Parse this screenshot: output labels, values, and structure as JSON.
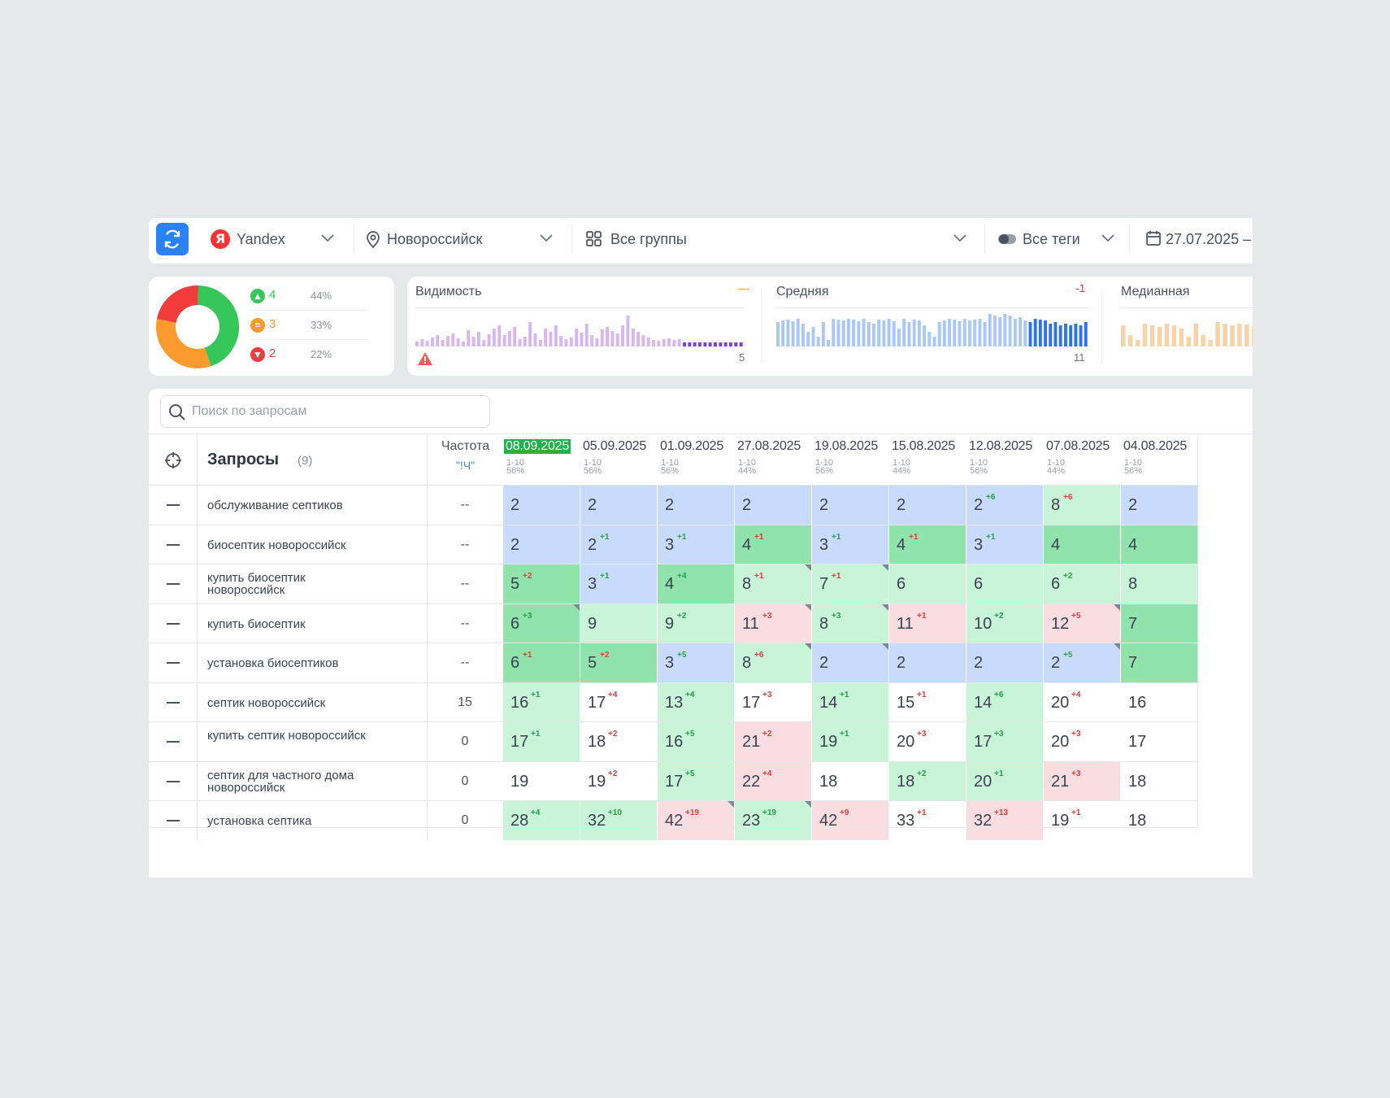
{
  "toolbar": {
    "engine": "Yandex",
    "engine_logo": "Я",
    "region": "Новороссийск",
    "groups": "Все группы",
    "tags": "Все теги",
    "date_range": "27.07.2025 –"
  },
  "summary": {
    "donut": {
      "segments": [
        {
          "name": "up",
          "count": "4",
          "pct": "44%",
          "color": "#35c759"
        },
        {
          "name": "same",
          "count": "3",
          "pct": "33%",
          "color": "#fb9a2d"
        },
        {
          "name": "down",
          "count": "2",
          "pct": "22%",
          "color": "#f23b3b"
        }
      ]
    },
    "sparks": [
      {
        "title": "Видимость",
        "delta": "—",
        "delta_color": "#fb9a2d",
        "value": "5",
        "color": "#d8b6f0",
        "highlight": "#7b3fe0",
        "warning": true
      },
      {
        "title": "Средняя",
        "delta": "-1",
        "delta_color": "#f23b3b",
        "value": "11",
        "color": "#a9c8f7",
        "highlight": "#2d74e6",
        "warning": false
      },
      {
        "title": "Медианная",
        "delta": "",
        "delta_color": "#f23b3b",
        "value": "",
        "color": "#f7d3aa",
        "highlight": "#f7d3aa",
        "warning": false
      }
    ]
  },
  "search": {
    "placeholder": "Поиск по запросам"
  },
  "table": {
    "title": "Запросы",
    "count": "(9)",
    "freq_title": "Частота",
    "freq_sub": "\"!Ч\"",
    "dates": [
      {
        "date": "08.09.2025",
        "range": "1-10",
        "pct": "56%",
        "active": true
      },
      {
        "date": "05.09.2025",
        "range": "1-10",
        "pct": "56%"
      },
      {
        "date": "01.09.2025",
        "range": "1-10",
        "pct": "56%"
      },
      {
        "date": "27.08.2025",
        "range": "1-10",
        "pct": "44%"
      },
      {
        "date": "19.08.2025",
        "range": "1-10",
        "pct": "56%"
      },
      {
        "date": "15.08.2025",
        "range": "1-10",
        "pct": "44%"
      },
      {
        "date": "12.08.2025",
        "range": "1-10",
        "pct": "56%"
      },
      {
        "date": "07.08.2025",
        "range": "1-10",
        "pct": "44%"
      },
      {
        "date": "04.08.2025",
        "range": "1-10",
        "pct": "56%"
      }
    ],
    "rows": [
      {
        "query": "обслуживание септиков",
        "freq": "--",
        "cells": [
          {
            "v": "2",
            "c": "blue"
          },
          {
            "v": "2",
            "c": "blue"
          },
          {
            "v": "2",
            "c": "blue"
          },
          {
            "v": "2",
            "c": "blue"
          },
          {
            "v": "2",
            "c": "blue"
          },
          {
            "v": "2",
            "c": "blue"
          },
          {
            "v": "2",
            "c": "blue",
            "d": "+6",
            "t": "up"
          },
          {
            "v": "8",
            "c": "lgreen",
            "d": "+6",
            "t": "down"
          },
          {
            "v": "2",
            "c": "blue"
          }
        ]
      },
      {
        "query": "биосептик новороссийск",
        "freq": "--",
        "cells": [
          {
            "v": "2",
            "c": "blue"
          },
          {
            "v": "2",
            "c": "blue",
            "d": "+1",
            "t": "up"
          },
          {
            "v": "3",
            "c": "blue",
            "d": "+1",
            "t": "up"
          },
          {
            "v": "4",
            "c": "dgreen",
            "d": "+1",
            "t": "down"
          },
          {
            "v": "3",
            "c": "blue",
            "d": "+1",
            "t": "up"
          },
          {
            "v": "4",
            "c": "dgreen",
            "d": "+1",
            "t": "down"
          },
          {
            "v": "3",
            "c": "blue",
            "d": "+1",
            "t": "up"
          },
          {
            "v": "4",
            "c": "dgreen"
          },
          {
            "v": "4",
            "c": "dgreen"
          }
        ]
      },
      {
        "query": "купить биосептик новороссийск",
        "freq": "--",
        "cells": [
          {
            "v": "5",
            "c": "dgreen",
            "d": "+2",
            "t": "down"
          },
          {
            "v": "3",
            "c": "blue",
            "d": "+1",
            "t": "up"
          },
          {
            "v": "4",
            "c": "dgreen",
            "d": "+4",
            "t": "up"
          },
          {
            "v": "8",
            "c": "lgreen",
            "d": "+1",
            "t": "down",
            "m": true
          },
          {
            "v": "7",
            "c": "lgreen",
            "d": "+1",
            "t": "down",
            "m": true
          },
          {
            "v": "6",
            "c": "lgreen"
          },
          {
            "v": "6",
            "c": "lgreen"
          },
          {
            "v": "6",
            "c": "lgreen",
            "d": "+2",
            "t": "up"
          },
          {
            "v": "8",
            "c": "lgreen"
          }
        ]
      },
      {
        "query": "купить биосептик",
        "freq": "--",
        "cells": [
          {
            "v": "6",
            "c": "dgreen",
            "d": "+3",
            "t": "up",
            "m": true
          },
          {
            "v": "9",
            "c": "lgreen"
          },
          {
            "v": "9",
            "c": "lgreen",
            "d": "+2",
            "t": "up"
          },
          {
            "v": "11",
            "c": "pink",
            "d": "+3",
            "t": "down",
            "m": true
          },
          {
            "v": "8",
            "c": "lgreen",
            "d": "+3",
            "t": "up",
            "m": true
          },
          {
            "v": "11",
            "c": "pink",
            "d": "+1",
            "t": "down"
          },
          {
            "v": "10",
            "c": "lgreen",
            "d": "+2",
            "t": "up"
          },
          {
            "v": "12",
            "c": "pink",
            "d": "+5",
            "t": "down",
            "m": true
          },
          {
            "v": "7",
            "c": "dgreen"
          }
        ]
      },
      {
        "query": "установка биосептиков",
        "freq": "--",
        "cells": [
          {
            "v": "6",
            "c": "dgreen",
            "d": "+1",
            "t": "down"
          },
          {
            "v": "5",
            "c": "dgreen",
            "d": "+2",
            "t": "down"
          },
          {
            "v": "3",
            "c": "blue",
            "d": "+5",
            "t": "up"
          },
          {
            "v": "8",
            "c": "lgreen",
            "d": "+6",
            "t": "down",
            "m": true
          },
          {
            "v": "2",
            "c": "blue",
            "m": true
          },
          {
            "v": "2",
            "c": "blue"
          },
          {
            "v": "2",
            "c": "blue"
          },
          {
            "v": "2",
            "c": "blue",
            "d": "+5",
            "t": "up",
            "m": true
          },
          {
            "v": "7",
            "c": "dgreen"
          }
        ]
      },
      {
        "query": "септик новороссийск",
        "freq": "15",
        "cells": [
          {
            "v": "16",
            "c": "lgreen",
            "d": "+1",
            "t": "up"
          },
          {
            "v": "17",
            "c": "white",
            "d": "+4",
            "t": "down"
          },
          {
            "v": "13",
            "c": "lgreen",
            "d": "+4",
            "t": "up"
          },
          {
            "v": "17",
            "c": "white",
            "d": "+3",
            "t": "down"
          },
          {
            "v": "14",
            "c": "lgreen",
            "d": "+1",
            "t": "up"
          },
          {
            "v": "15",
            "c": "white",
            "d": "+1",
            "t": "down"
          },
          {
            "v": "14",
            "c": "lgreen",
            "d": "+6",
            "t": "up"
          },
          {
            "v": "20",
            "c": "white",
            "d": "+4",
            "t": "down"
          },
          {
            "v": "16",
            "c": "white"
          }
        ]
      },
      {
        "query": "купить септик новороссийск",
        "freq": "0",
        "cells": [
          {
            "v": "17",
            "c": "lgreen",
            "d": "+1",
            "t": "up"
          },
          {
            "v": "18",
            "c": "white",
            "d": "+2",
            "t": "down"
          },
          {
            "v": "16",
            "c": "lgreen",
            "d": "+5",
            "t": "up"
          },
          {
            "v": "21",
            "c": "pink",
            "d": "+2",
            "t": "down"
          },
          {
            "v": "19",
            "c": "lgreen",
            "d": "+1",
            "t": "up"
          },
          {
            "v": "20",
            "c": "white",
            "d": "+3",
            "t": "down"
          },
          {
            "v": "17",
            "c": "lgreen",
            "d": "+3",
            "t": "up"
          },
          {
            "v": "20",
            "c": "white",
            "d": "+3",
            "t": "down"
          },
          {
            "v": "17",
            "c": "white"
          }
        ]
      },
      {
        "query": "септик для частного дома новороссийск",
        "freq": "0",
        "cells": [
          {
            "v": "19",
            "c": "white"
          },
          {
            "v": "19",
            "c": "white",
            "d": "+2",
            "t": "down"
          },
          {
            "v": "17",
            "c": "lgreen",
            "d": "+5",
            "t": "up"
          },
          {
            "v": "22",
            "c": "pink",
            "d": "+4",
            "t": "down"
          },
          {
            "v": "18",
            "c": "white"
          },
          {
            "v": "18",
            "c": "lgreen",
            "d": "+2",
            "t": "up"
          },
          {
            "v": "20",
            "c": "lgreen",
            "d": "+1",
            "t": "up"
          },
          {
            "v": "21",
            "c": "pink",
            "d": "+3",
            "t": "down"
          },
          {
            "v": "18",
            "c": "white"
          }
        ]
      },
      {
        "query": "установка септика",
        "freq": "0",
        "cells": [
          {
            "v": "28",
            "c": "lgreen",
            "d": "+4",
            "t": "up"
          },
          {
            "v": "32",
            "c": "lgreen",
            "d": "+10",
            "t": "up"
          },
          {
            "v": "42",
            "c": "pink",
            "d": "+19",
            "t": "down",
            "m": true
          },
          {
            "v": "23",
            "c": "lgreen",
            "d": "+19",
            "t": "up",
            "m": true
          },
          {
            "v": "42",
            "c": "pink",
            "d": "+9",
            "t": "down"
          },
          {
            "v": "33",
            "c": "white",
            "d": "+1",
            "t": "down"
          },
          {
            "v": "32",
            "c": "pink",
            "d": "+13",
            "t": "down"
          },
          {
            "v": "19",
            "c": "white",
            "d": "+1",
            "t": "down"
          },
          {
            "v": "18",
            "c": "white"
          }
        ]
      }
    ]
  }
}
